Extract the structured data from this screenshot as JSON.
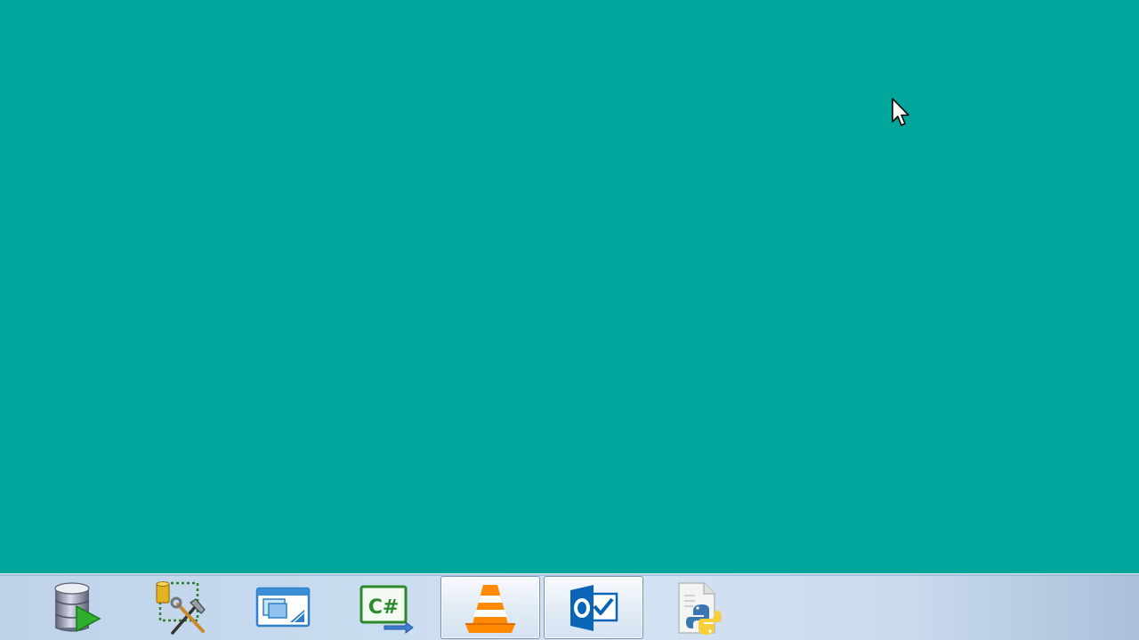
{
  "desktop": {
    "background_color": "#00a69c"
  },
  "cursor": {
    "icon": "arrow-pointer-icon"
  },
  "taskbar": {
    "items": [
      {
        "icon": "database-run-icon",
        "open": false
      },
      {
        "icon": "database-design-tools-icon",
        "open": false
      },
      {
        "icon": "window-designer-icon",
        "open": false
      },
      {
        "icon": "csharp-project-icon",
        "open": false
      },
      {
        "icon": "vlc-media-player-icon",
        "open": true
      },
      {
        "icon": "outlook-icon",
        "open": true
      },
      {
        "icon": "python-file-icon",
        "open": false
      }
    ]
  }
}
